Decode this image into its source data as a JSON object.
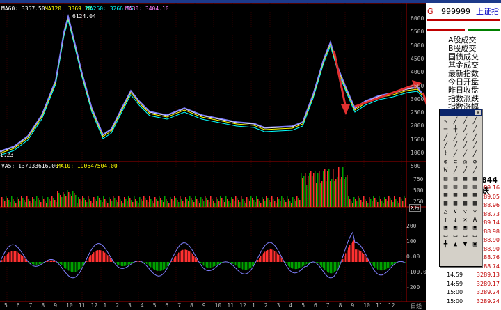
{
  "top_labels": {
    "ma60": "MA60: 3357.50",
    "ma120": "MA120: 3369.28",
    "ma250": "MA250: 3266.85",
    "ma30": "MA30: 3404.10",
    "peak": "6124.04",
    "trough": "1.23"
  },
  "volume_labels": {
    "vol": "VA5: 137933616.00",
    "ma10": "MA10: 190647504.00",
    "unit": "X万"
  },
  "price_axis": [
    "6000",
    "5500",
    "5000",
    "4500",
    "4000",
    "3500",
    "3000",
    "2500",
    "2000",
    "1500",
    "1000",
    "500"
  ],
  "volume_axis": [
    "750",
    "500",
    "250"
  ],
  "macd_axis": [
    "200",
    "100",
    "0.00",
    "-100.00",
    "-200"
  ],
  "x_ticks": [
    "5",
    "6",
    "7",
    "8",
    "9",
    "10",
    "11",
    "12",
    "1",
    "2",
    "3",
    "4",
    "5",
    "6",
    "7",
    "8",
    "9",
    "10",
    "11",
    "12",
    "1",
    "2",
    "3",
    "4",
    "5",
    "6",
    "7",
    "8",
    "9",
    "10",
    "11",
    "12",
    "日线"
  ],
  "right_panel": {
    "code_prefix": "G",
    "code": "999999",
    "name": "上证指",
    "menu": [
      "A股成交",
      "B股成交",
      "国债成交",
      "基金成交",
      "最新指数",
      "今日开盘",
      "昨日收盘",
      "指数涨跌",
      "指数涨幅"
    ],
    "side_num": "844",
    "side_label": "跌",
    "trades": [
      {
        "time": "",
        "price": "289.16"
      },
      {
        "time": "",
        "price": "289.05"
      },
      {
        "time": "",
        "price": "288.96"
      },
      {
        "time": "",
        "price": "288.73"
      },
      {
        "time": "",
        "price": "289.14"
      },
      {
        "time": "",
        "price": "288.98"
      },
      {
        "time": "",
        "price": "288.90"
      },
      {
        "time": "",
        "price": "288.90"
      },
      {
        "time": "",
        "price": "288.76"
      },
      {
        "time": "14:59",
        "price": "3288.74"
      },
      {
        "time": "14:59",
        "price": "3289.13"
      },
      {
        "time": "14:59",
        "price": "3289.17"
      },
      {
        "time": "15:00",
        "price": "3289.24"
      },
      {
        "time": "15:00",
        "price": "3289.24"
      }
    ]
  },
  "colors": {
    "up": "#ff3030",
    "down": "#00a000",
    "ma1": "#ffffff",
    "ma2": "#ffff00",
    "ma3": "#00ffff",
    "k": "#8080ff",
    "accent": "#e03030"
  }
}
